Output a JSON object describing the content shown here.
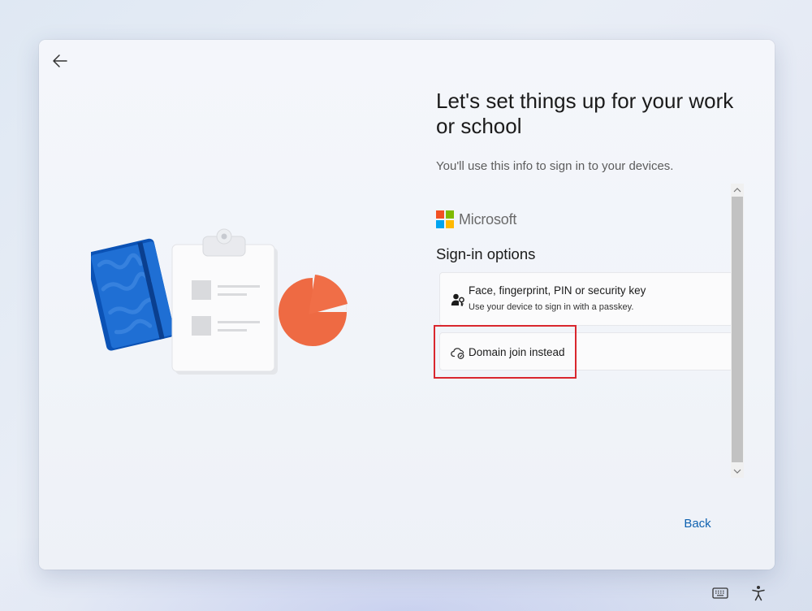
{
  "header": {
    "title": "Let's set things up for your work or school",
    "subtitle": "You'll use this info to sign in to your devices."
  },
  "brand": {
    "name": "Microsoft",
    "colors": [
      "#f25022",
      "#7fba00",
      "#00a4ef",
      "#ffb900"
    ]
  },
  "signin": {
    "heading": "Sign-in options",
    "options": [
      {
        "title": "Face, fingerprint, PIN or security key",
        "description": "Use your device to sign in with a passkey.",
        "icon": "person-key-icon"
      },
      {
        "title": "Domain join instead",
        "icon": "cloud-sync-icon"
      }
    ]
  },
  "footer": {
    "back_label": "Back"
  },
  "icons": {
    "back": "back-arrow-icon",
    "keyboard": "keyboard-icon",
    "accessibility": "accessibility-icon"
  },
  "colors": {
    "accent": "#0f62b0",
    "highlight": "#d9272e"
  }
}
